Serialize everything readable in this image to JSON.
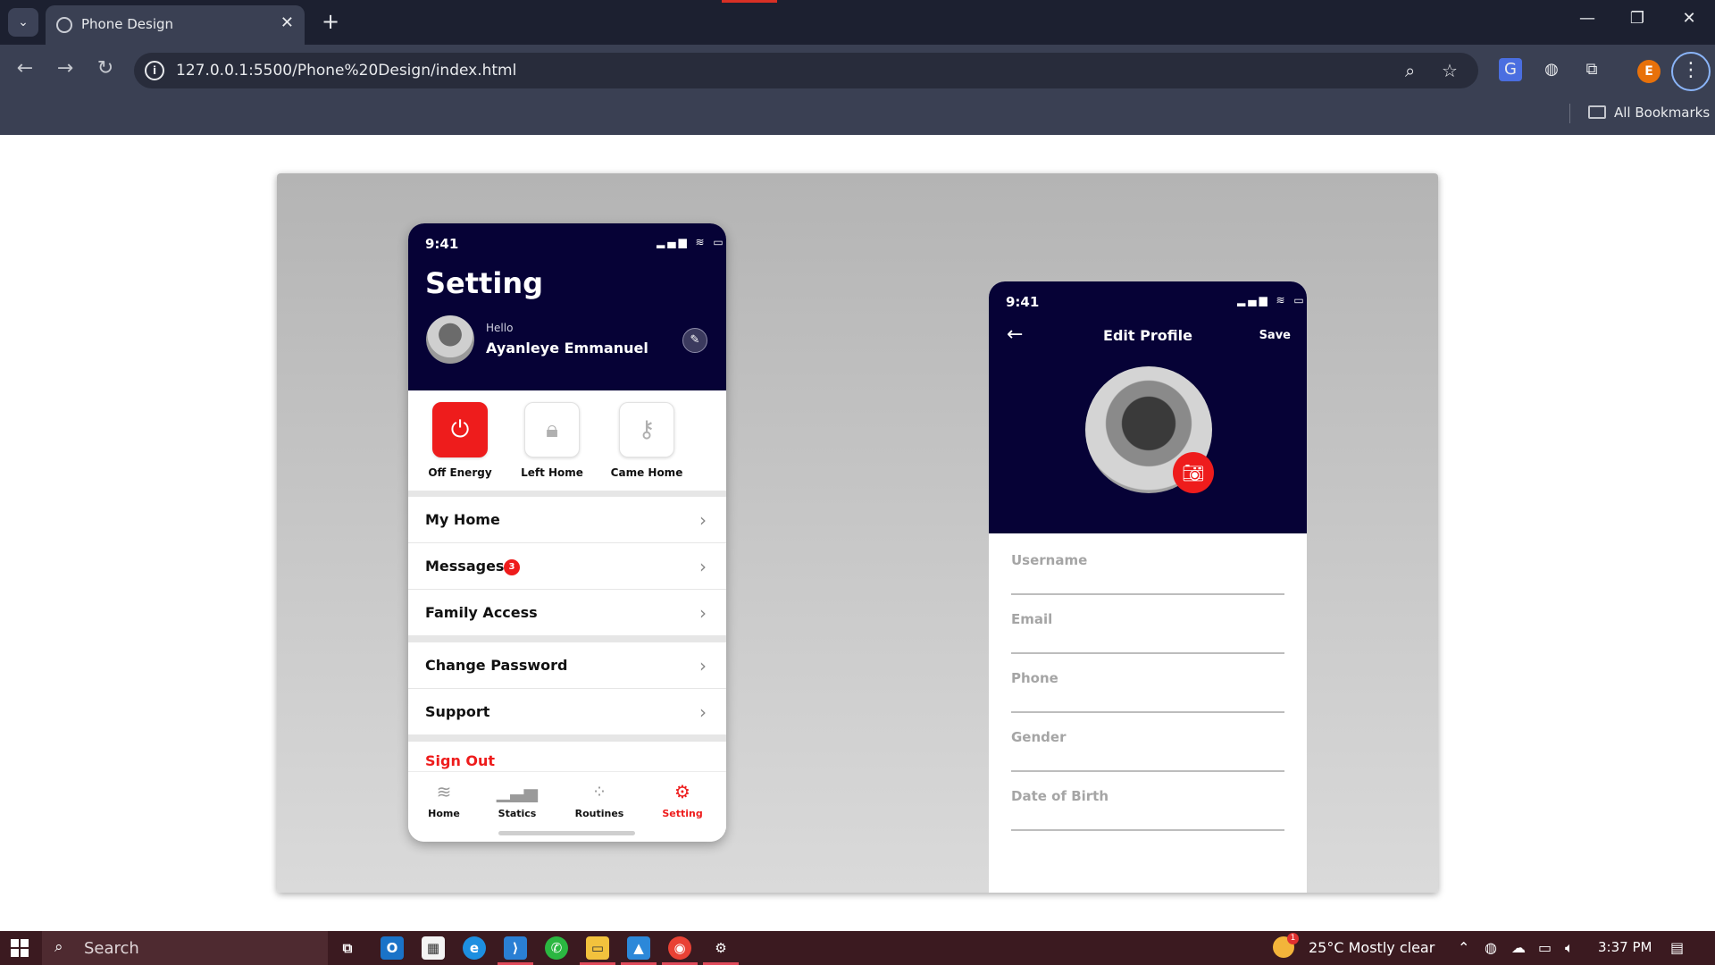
{
  "browser": {
    "tab_title": "Phone Design",
    "tab_close": "✕",
    "new_tab": "+",
    "url": "127.0.0.1:5500/Phone%20Design/index.html",
    "bookmarks_label": "All Bookmarks",
    "profile_initial": "E"
  },
  "settings_screen": {
    "time": "9:41",
    "title": "Setting",
    "greeting": "Hello",
    "user_name": "Ayanleye Emmanuel",
    "quick_actions": [
      {
        "label": "Off Energy",
        "icon": "power-icon",
        "active": true
      },
      {
        "label": "Left Home",
        "icon": "lock-icon",
        "active": false
      },
      {
        "label": "Came Home",
        "icon": "key-icon",
        "active": false
      }
    ],
    "menu": [
      {
        "label": "My Home"
      },
      {
        "label": "Messages",
        "badge": "3"
      },
      {
        "label": "Family Access"
      },
      {
        "label": "Change Password"
      },
      {
        "label": "Support"
      }
    ],
    "sign_out": "Sign Out",
    "tabs": [
      {
        "label": "Home",
        "icon": "wifi-icon",
        "active": false
      },
      {
        "label": "Statics",
        "icon": "bar-chart-icon",
        "active": false
      },
      {
        "label": "Routines",
        "icon": "dots-circle-icon",
        "active": false
      },
      {
        "label": "Setting",
        "icon": "gear-icon",
        "active": true
      }
    ]
  },
  "edit_profile_screen": {
    "time": "9:41",
    "title": "Edit Profile",
    "save_label": "Save",
    "fields": [
      "Username",
      "Email",
      "Phone",
      "Gender",
      "Date of Birth"
    ]
  },
  "taskbar": {
    "search_placeholder": "Search",
    "weather_badge": "1",
    "weather": "25°C  Mostly clear",
    "time": "3:37 PM"
  },
  "colors": {
    "header_navy": "#060236",
    "accent_red": "#ee1c1c",
    "browser_dark": "#1c2030",
    "taskbar": "#3b1a20"
  }
}
